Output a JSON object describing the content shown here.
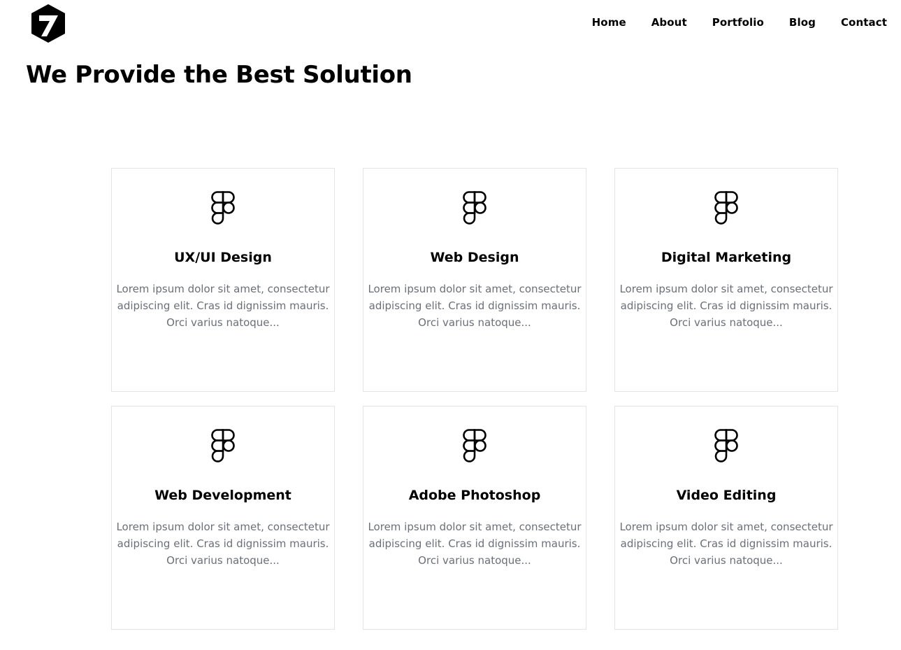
{
  "brand": {
    "logo_icon": "hexagon-seven-logo-icon",
    "logo_color": "#000000"
  },
  "nav": {
    "items": [
      {
        "label": "Home"
      },
      {
        "label": "About"
      },
      {
        "label": "Portfolio"
      },
      {
        "label": "Blog"
      },
      {
        "label": "Contact"
      }
    ]
  },
  "hero": {
    "title": "We Provide the Best Solution"
  },
  "services": [
    {
      "icon": "figma-icon",
      "title": "UX/UI Design",
      "description": "Lorem ipsum dolor sit amet, consectetur adipiscing elit. Cras id dignissim mauris. Orci varius natoque..."
    },
    {
      "icon": "figma-icon",
      "title": "Web Design",
      "description": "Lorem ipsum dolor sit amet, consectetur adipiscing elit. Cras id dignissim mauris. Orci varius natoque..."
    },
    {
      "icon": "figma-icon",
      "title": "Digital Marketing",
      "description": "Lorem ipsum dolor sit amet, consectetur adipiscing elit. Cras id dignissim mauris. Orci varius natoque..."
    },
    {
      "icon": "figma-icon",
      "title": "Web Development",
      "description": "Lorem ipsum dolor sit amet, consectetur adipiscing elit. Cras id dignissim mauris. Orci varius natoque..."
    },
    {
      "icon": "figma-icon",
      "title": "Adobe Photoshop",
      "description": "Lorem ipsum dolor sit amet, consectetur adipiscing elit. Cras id dignissim mauris. Orci varius natoque..."
    },
    {
      "icon": "figma-icon",
      "title": "Video Editing",
      "description": "Lorem ipsum dolor sit amet, consectetur adipiscing elit. Cras id dignissim mauris. Orci varius natoque..."
    }
  ],
  "colors": {
    "text": "#000000",
    "muted_text": "#6b6f78",
    "card_border": "#e4e4e4",
    "background": "#ffffff"
  }
}
